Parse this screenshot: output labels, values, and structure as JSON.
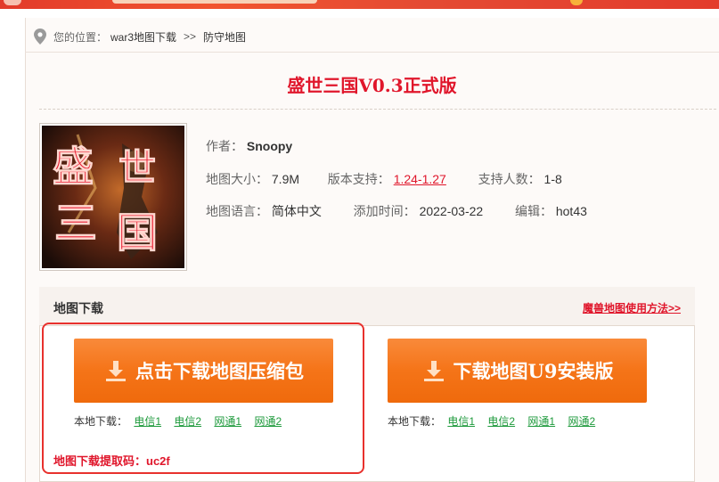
{
  "breadcrumb": {
    "prefix": "您的位置：",
    "items": [
      "war3地图下载",
      "防守地图"
    ],
    "separator": ">>"
  },
  "map": {
    "title": "盛世三国V0.3正式版",
    "author_label": "作者：",
    "author": "Snoopy",
    "size_label": "地图大小：",
    "size": "7.9M",
    "version_label": "版本支持：",
    "version": "1.24-1.27",
    "players_label": "支持人数：",
    "players": "1-8",
    "language_label": "地图语言：",
    "language": "简体中文",
    "added_label": "添加时间：",
    "added": "2022-03-22",
    "editor_label": "编辑：",
    "editor": "hot43",
    "thumbnail_text": [
      "盛",
      "世",
      "三",
      "国"
    ]
  },
  "download": {
    "heading": "地图下载",
    "howto_link": "魔兽地图使用方法>>",
    "buttons": [
      {
        "label": "点击下载地图压缩包",
        "icon": "download-icon"
      },
      {
        "label": "下载地图U9安装版",
        "icon": "download-icon"
      }
    ],
    "local_label": "本地下载：",
    "mirrors": [
      "电信1",
      "电信2",
      "网通1",
      "网通2"
    ],
    "extract_code": "地图下载提取码：uc2f"
  },
  "colors": {
    "accent_red": "#e0162b",
    "button_orange": "#f57418",
    "mirror_green": "#1e9a3c"
  }
}
